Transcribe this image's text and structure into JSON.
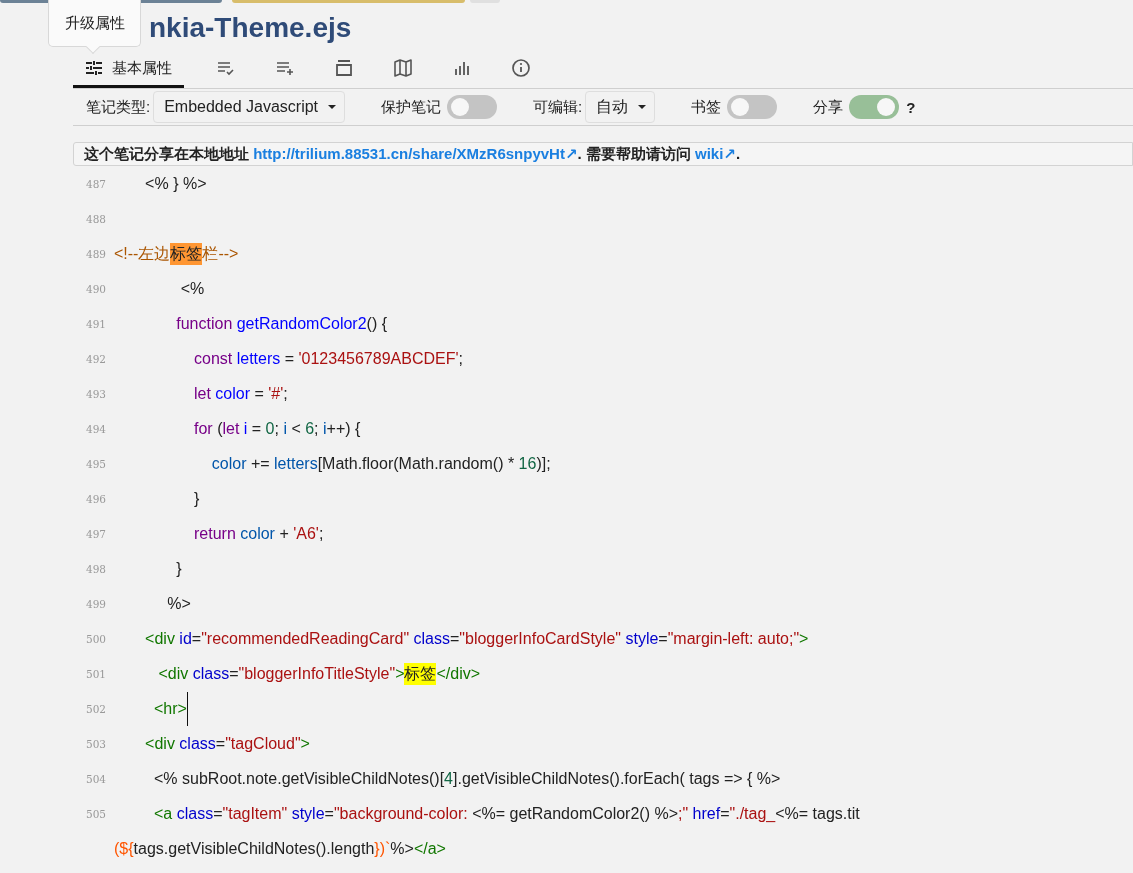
{
  "tooltip": {
    "text": "升级属性"
  },
  "title": "nkia-Theme.ejs",
  "ribbon_tabs": [
    {
      "label": "基本属性",
      "selected": true
    },
    {
      "selected": false
    },
    {
      "selected": false
    },
    {
      "selected": false
    },
    {
      "selected": false
    },
    {
      "selected": false
    },
    {
      "selected": false
    }
  ],
  "properties": [
    {
      "kind": "dropdown",
      "label": "笔记类型:",
      "value": "Embedded Javascript"
    },
    {
      "kind": "toggle",
      "label": "保护笔记",
      "on": false
    },
    {
      "kind": "dropdown",
      "label": "可编辑:",
      "value": "自动"
    },
    {
      "kind": "toggle",
      "label": "书签",
      "on": false
    },
    {
      "kind": "toggle",
      "label": "分享",
      "on": true,
      "help": "?"
    }
  ],
  "share_notice": [
    {
      "kind": "text",
      "text": "这个笔记分享在本地地址 "
    },
    {
      "kind": "link",
      "text": "http://trilium.88531.cn/share/XMzR6snpyvHt↗"
    },
    {
      "kind": "text",
      "text": ". 需要帮助请访问 "
    },
    {
      "kind": "link",
      "text": "wiki↗"
    },
    {
      "kind": "text",
      "text": "."
    }
  ],
  "code_lines": [
    {
      "number": "487",
      "tokens": [
        {
          "kind": "plain",
          "text": "       <% } %>"
        }
      ]
    },
    {
      "number": "488"
    },
    {
      "number": "489",
      "tokens": [
        {
          "kind": "comment",
          "text": "<!--左边"
        },
        {
          "kind": "match",
          "text": "标签"
        },
        {
          "kind": "comment",
          "text": "栏-->"
        }
      ]
    },
    {
      "number": "490",
      "tokens": [
        {
          "kind": "plain",
          "text": "               <%"
        }
      ]
    },
    {
      "number": "491",
      "tokens": [
        {
          "kind": "keyword",
          "text": "              function "
        },
        {
          "kind": "def",
          "text": "getRandomColor2"
        },
        {
          "kind": "plain",
          "text": "() {"
        }
      ]
    },
    {
      "number": "492",
      "tokens": [
        {
          "kind": "keyword",
          "text": "                  const "
        },
        {
          "kind": "def",
          "text": "letters"
        },
        {
          "kind": "plain",
          "text": " = "
        },
        {
          "kind": "string",
          "text": "'0123456789ABCDEF'"
        },
        {
          "kind": "plain",
          "text": ";"
        }
      ]
    },
    {
      "number": "493",
      "tokens": [
        {
          "kind": "keyword",
          "text": "                  let "
        },
        {
          "kind": "def",
          "text": "color"
        },
        {
          "kind": "plain",
          "text": " = "
        },
        {
          "kind": "string",
          "text": "'#'"
        },
        {
          "kind": "plain",
          "text": ";"
        }
      ]
    },
    {
      "number": "494",
      "tokens": [
        {
          "kind": "keyword",
          "text": "                  for"
        },
        {
          "kind": "plain",
          "text": " ("
        },
        {
          "kind": "keyword",
          "text": "let "
        },
        {
          "kind": "def",
          "text": "i"
        },
        {
          "kind": "plain",
          "text": " = "
        },
        {
          "kind": "number",
          "text": "0"
        },
        {
          "kind": "plain",
          "text": "; "
        },
        {
          "kind": "variable",
          "text": "i"
        },
        {
          "kind": "plain",
          "text": " < "
        },
        {
          "kind": "number",
          "text": "6"
        },
        {
          "kind": "plain",
          "text": "; "
        },
        {
          "kind": "variable",
          "text": "i"
        },
        {
          "kind": "plain",
          "text": "++) {"
        }
      ]
    },
    {
      "number": "495",
      "tokens": [
        {
          "kind": "variable",
          "text": "                      color"
        },
        {
          "kind": "plain",
          "text": " += "
        },
        {
          "kind": "variable",
          "text": "letters"
        },
        {
          "kind": "plain",
          "text": "[Math.floor(Math.random() * "
        },
        {
          "kind": "number",
          "text": "16"
        },
        {
          "kind": "plain",
          "text": ")];"
        }
      ]
    },
    {
      "number": "496",
      "tokens": [
        {
          "kind": "plain",
          "text": "                  }"
        }
      ]
    },
    {
      "number": "497",
      "tokens": [
        {
          "kind": "keyword",
          "text": "                  return "
        },
        {
          "kind": "variable",
          "text": "color"
        },
        {
          "kind": "plain",
          "text": " + "
        },
        {
          "kind": "string",
          "text": "'A6'"
        },
        {
          "kind": "plain",
          "text": ";"
        }
      ]
    },
    {
      "number": "498",
      "tokens": [
        {
          "kind": "plain",
          "text": "              }"
        }
      ]
    },
    {
      "number": "499",
      "tokens": [
        {
          "kind": "plain",
          "text": "            %>"
        }
      ]
    },
    {
      "number": "500",
      "tokens": [
        {
          "kind": "tag",
          "text": "       <div "
        },
        {
          "kind": "attr",
          "text": "id"
        },
        {
          "kind": "plain",
          "text": "="
        },
        {
          "kind": "string",
          "text": "\"recommendedReadingCard\" "
        },
        {
          "kind": "attr",
          "text": "class"
        },
        {
          "kind": "plain",
          "text": "="
        },
        {
          "kind": "string",
          "text": "\"bloggerInfoCardStyle\" "
        },
        {
          "kind": "attr",
          "text": "style"
        },
        {
          "kind": "plain",
          "text": "="
        },
        {
          "kind": "string",
          "text": "\"margin-left: auto;\""
        },
        {
          "kind": "tag",
          "text": ">"
        }
      ]
    },
    {
      "number": "501",
      "tokens": [
        {
          "kind": "tag",
          "text": "          <div "
        },
        {
          "kind": "attr",
          "text": "class"
        },
        {
          "kind": "plain",
          "text": "="
        },
        {
          "kind": "string",
          "text": "\"bloggerInfoTitleStyle\""
        },
        {
          "kind": "tag",
          "text": ">"
        },
        {
          "kind": "highlight",
          "text": "标签"
        },
        {
          "kind": "tag",
          "text": "</div>"
        }
      ]
    },
    {
      "number": "502",
      "cursor": true,
      "tokens": [
        {
          "kind": "tag",
          "text": "         <hr>"
        }
      ]
    },
    {
      "number": "503",
      "tokens": [
        {
          "kind": "tag",
          "text": "       <div "
        },
        {
          "kind": "attr",
          "text": "class"
        },
        {
          "kind": "plain",
          "text": "="
        },
        {
          "kind": "string",
          "text": "\"tagCloud\""
        },
        {
          "kind": "tag",
          "text": ">"
        }
      ]
    },
    {
      "number": "504",
      "tokens": [
        {
          "kind": "plain",
          "text": "         <% subRoot.note.getVisibleChildNotes()["
        },
        {
          "kind": "number",
          "text": "4"
        },
        {
          "kind": "plain",
          "text": "].getVisibleChildNotes().forEach( tags => { %>"
        }
      ]
    },
    {
      "number": "505",
      "tokens": [
        {
          "kind": "tag",
          "text": "         <a "
        },
        {
          "kind": "attr",
          "text": "class"
        },
        {
          "kind": "plain",
          "text": "="
        },
        {
          "kind": "string",
          "text": "\"tagItem\" "
        },
        {
          "kind": "attr",
          "text": "style"
        },
        {
          "kind": "plain",
          "text": "="
        },
        {
          "kind": "string",
          "text": "\"background-color: "
        },
        {
          "kind": "plain",
          "text": "<%= getRandomColor2() %>"
        },
        {
          "kind": "string",
          "text": ";\" "
        },
        {
          "kind": "attr",
          "text": "href"
        },
        {
          "kind": "plain",
          "text": "="
        },
        {
          "kind": "string",
          "text": "\"./tag_"
        },
        {
          "kind": "plain",
          "text": "<%= tags.tit"
        }
      ]
    },
    {
      "tokens": [
        {
          "kind": "ejs",
          "text": "(${"
        },
        {
          "kind": "plain",
          "text": "tags.getVisibleChildNotes().length"
        },
        {
          "kind": "ejs",
          "text": "})`"
        },
        {
          "kind": "plain",
          "text": "%>"
        },
        {
          "kind": "tag",
          "text": "</a>"
        }
      ]
    }
  ]
}
